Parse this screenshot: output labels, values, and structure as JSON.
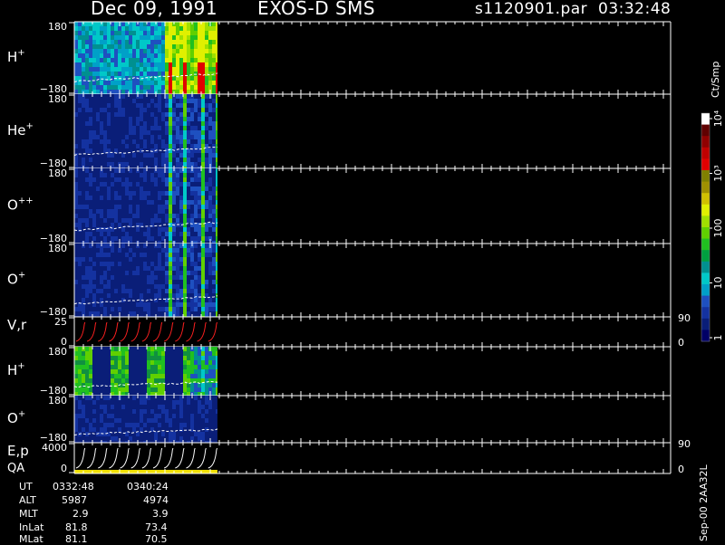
{
  "header": {
    "date": "Dec 09, 1991",
    "instrument": "EXOS-D SMS",
    "file": "s1120901.par",
    "time": "03:32:48"
  },
  "colors": {
    "background": "#000000",
    "axis": "#ffffff",
    "spectrogram_bg": "#0a1e78",
    "vr_trace": "#ff2020",
    "qa_bar": "#f0e000"
  },
  "colorbar": {
    "unit_label": "Ct/Smp",
    "tick_labels": [
      "1",
      "10",
      "100",
      "10³",
      "10⁴"
    ],
    "colors": [
      "#000066",
      "#0a1e78",
      "#1432a0",
      "#1e50c0",
      "#00a0c8",
      "#00c8c8",
      "#009090",
      "#00a040",
      "#20c020",
      "#60d000",
      "#a0e000",
      "#e0f000",
      "#d0c000",
      "#a09000",
      "#808000",
      "#e00000",
      "#c00000",
      "#900000",
      "#600000",
      "#ffffff"
    ]
  },
  "footer": {
    "version": "Sep-00 2AA32L",
    "rows": [
      {
        "label": "UT",
        "v1": "0332:48",
        "v2": "0340:24"
      },
      {
        "label": "ALT",
        "v1": "5987",
        "v2": "4974"
      },
      {
        "label": "MLT",
        "v1": "2.9",
        "v2": "3.9"
      },
      {
        "label": "InLat",
        "v1": "81.8",
        "v2": "73.4"
      },
      {
        "label": "MLat",
        "v1": "81.1",
        "v2": "70.5"
      }
    ]
  },
  "chart_data": [
    {
      "type": "heatmap",
      "panel": "H+",
      "ylabel": "H+",
      "ytick_top": "180",
      "ytick_bottom": "−180",
      "ylim": [
        -180,
        180
      ],
      "data_extent_fraction": 0.24,
      "dominant_level": "green-yellow with red bands"
    },
    {
      "type": "heatmap",
      "panel": "He+",
      "ylabel": "He+",
      "ytick_top": "180",
      "ytick_bottom": "−180",
      "ylim": [
        -180,
        180
      ],
      "data_extent_fraction": 0.24,
      "dominant_level": "dark blue with cyan/green bands"
    },
    {
      "type": "heatmap",
      "panel": "O++",
      "ylabel": "O++",
      "ytick_top": "180",
      "ytick_bottom": "−180",
      "ylim": [
        -180,
        180
      ],
      "data_extent_fraction": 0.24,
      "dominant_level": "dark blue with green bands"
    },
    {
      "type": "heatmap",
      "panel": "O+",
      "ylabel": "O+",
      "ytick_top": "180",
      "ytick_bottom": "−180",
      "ylim": [
        -180,
        180
      ],
      "data_extent_fraction": 0.24,
      "dominant_level": "dark blue with green bands"
    },
    {
      "type": "line",
      "panel": "V,r",
      "ylabel": "V,r",
      "ytick_top": "25",
      "ytick_bottom": "0",
      "right_top": "90",
      "right_bottom": "0",
      "ylim": [
        0,
        25
      ],
      "sawtooth_cycles": 13
    },
    {
      "type": "heatmap",
      "panel": "H+ (2)",
      "ylabel": "H+",
      "ytick_top": "180",
      "ytick_bottom": "−180",
      "ylim": [
        -180,
        180
      ],
      "data_extent_fraction": 0.24,
      "dominant_level": "green vertical stripes"
    },
    {
      "type": "heatmap",
      "panel": "O+ (2)",
      "ylabel": "O+",
      "ytick_top": "180",
      "ytick_bottom": "−180",
      "ylim": [
        -180,
        180
      ],
      "data_extent_fraction": 0.24,
      "dominant_level": "dark blue"
    },
    {
      "type": "line",
      "panel": "E,p QA",
      "ylabel": "E,p",
      "ylabel2": "QA",
      "ytick_top": "4000",
      "ytick_bottom": "0",
      "right_top": "90",
      "right_bottom": "0",
      "ylim": [
        0,
        4000
      ],
      "sawtooth_cycles": 13
    }
  ]
}
